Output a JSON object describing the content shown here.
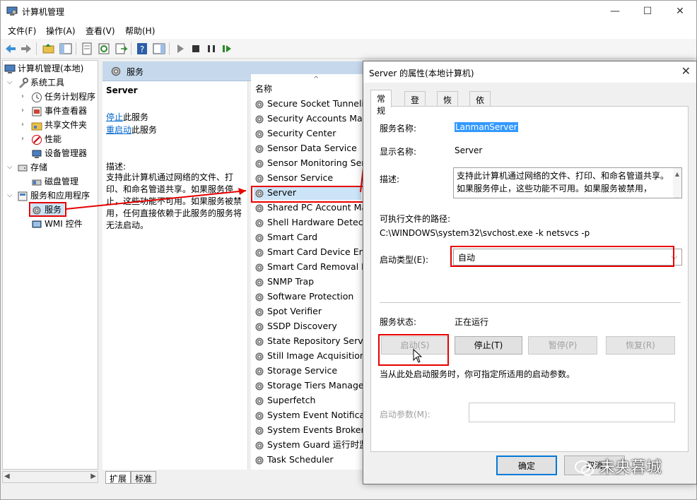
{
  "window": {
    "title": "计算机管理",
    "controls": {
      "minimize": "—",
      "maximize": "☐",
      "close": "✕"
    }
  },
  "menubar": [
    "文件(F)",
    "操作(A)",
    "查看(V)",
    "帮助(H)"
  ],
  "tree": {
    "root": "计算机管理(本地)",
    "system_tools": "系统工具",
    "task_scheduler": "任务计划程序",
    "event_viewer": "事件查看器",
    "shared_folders": "共享文件夹",
    "performance": "性能",
    "device_manager": "设备管理器",
    "storage": "存储",
    "disk_management": "磁盘管理",
    "services_apps": "服务和应用程序",
    "services": "服务",
    "wmi": "WMI 控件"
  },
  "services_pane": {
    "header": "服务",
    "selected_name": "Server",
    "stop_link": "停止",
    "stop_suffix": "此服务",
    "restart_link": "重启动",
    "restart_suffix": "此服务",
    "desc_label": "描述:",
    "desc_text": "支持此计算机通过网络的文件、打印、和命名管道共享。如果服务停止，这些功能不可用。如果服务被禁用，任何直接依赖于此服务的服务将无法启动。",
    "column_name": "名称",
    "items": [
      "Secure Socket Tunneling",
      "Security Accounts Mana",
      "Security Center",
      "Sensor Data Service",
      "Sensor Monitoring Serv",
      "Sensor Service",
      "Server",
      "Shared PC Account Ma",
      "Shell Hardware Detectio",
      "Smart Card",
      "Smart Card Device Enu",
      "Smart Card Removal Po",
      "SNMP Trap",
      "Software Protection",
      "Spot Verifier",
      "SSDP Discovery",
      "State Repository Servic",
      "Still Image Acquisition E",
      "Storage Service",
      "Storage Tiers Manager",
      "Superfetch",
      "System Event Notificatio",
      "System Events Broker",
      "System Guard 运行时监",
      "Task Scheduler"
    ],
    "bottom_tabs": [
      "扩展",
      "标准"
    ]
  },
  "dialog": {
    "title": "Server 的属性(本地计算机)",
    "tabs": [
      "常规",
      "登录",
      "恢复",
      "依存关系"
    ],
    "service_name_label": "服务名称:",
    "service_name_value": "LanmanServer",
    "display_name_label": "显示名称:",
    "display_name_value": "Server",
    "description_label": "描述:",
    "description_value": "支持此计算机通过网络的文件、打印、和命名管道共享。如果服务停止，这些功能不可用。如果服务被禁用，",
    "exe_path_label": "可执行文件的路径:",
    "exe_path_value": "C:\\WINDOWS\\system32\\svchost.exe -k netsvcs -p",
    "startup_type_label": "启动类型(E):",
    "startup_type_value": "自动",
    "status_label": "服务状态:",
    "status_value": "正在运行",
    "buttons": {
      "start": "启动(S)",
      "stop": "停止(T)",
      "pause": "暂停(P)",
      "resume": "恢复(R)"
    },
    "hint": "当从此处启动服务时，你可指定所适用的启动参数。",
    "params_label": "启动参数(M):",
    "ok": "确定",
    "cancel": "取消"
  },
  "watermark": "未央暮城",
  "colors": {
    "highlight_red": "#e60000",
    "selection_blue": "#3399ff",
    "link": "#0066cc"
  }
}
